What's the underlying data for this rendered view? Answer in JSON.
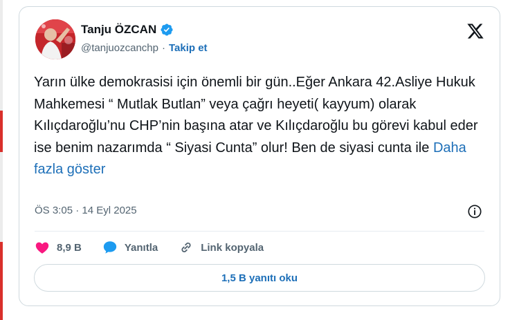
{
  "author": {
    "name": "Tanju ÖZCAN",
    "handle": "@tanjuozcanchp",
    "separator": "·",
    "follow_label": "Takip et"
  },
  "tweet": {
    "text": "Yarın ülke demokrasisi için önemli bir gün..Eğer Ankara 42.Asliye Hukuk Mahkemesi “ Mutlak Butlan” veya çağrı heyeti( kayyum) olarak Kılıçdaroğlu’nu CHP’nin başına atar ve Kılıçdaroğlu bu görevi kabul eder ise benim nazarımda “ Siyasi Cunta” olur! Ben de siyasi cunta ile ",
    "show_more": "Daha fazla göster",
    "timestamp": "ÖS 3:05 · 14 Eyl 2025"
  },
  "actions": {
    "likes": "8,9 B",
    "reply_label": "Yanıtla",
    "copy_link_label": "Link kopyala"
  },
  "read_replies_label": "1,5 B yanıtı oku",
  "icons": {
    "verified": "verified-badge-icon",
    "platform": "x-logo-icon",
    "info": "info-icon",
    "like": "heart-icon",
    "reply": "speech-bubble-icon",
    "link": "link-icon"
  },
  "colors": {
    "accent": "#1d6fb8",
    "like": "#f91880",
    "verified": "#1d9bf0",
    "text": "#0f1419",
    "muted": "#536471"
  }
}
